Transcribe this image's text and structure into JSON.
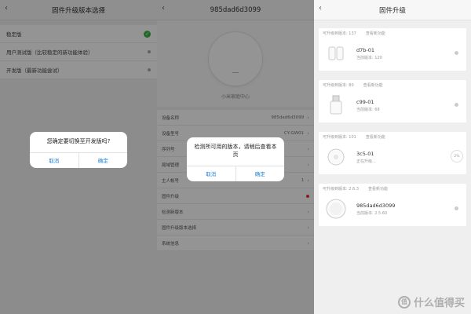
{
  "panel1": {
    "title": "固件升级版本选择",
    "back_icon": "chevron-left-icon",
    "options": [
      {
        "label": "稳定版",
        "state": "checked"
      },
      {
        "label": "用户测试版（比较稳定的新功能体验）",
        "state": "dot"
      },
      {
        "label": "开发版（最新功能尝试）",
        "state": "dot"
      }
    ],
    "dialog": {
      "message": "您确定要切换至开发版吗?",
      "cancel": "取消",
      "confirm": "确定"
    }
  },
  "panel2": {
    "title": "985dad6d3099",
    "back_icon": "chevron-left-icon",
    "device_label": "小米家庭中心",
    "rows": [
      {
        "label": "设备名称",
        "value": "985dad6d3099"
      },
      {
        "label": "设备型号",
        "value": "CY-GW01"
      },
      {
        "label": "序列号",
        "value": ""
      },
      {
        "label": "局域管理",
        "value": ""
      },
      {
        "label": "主人帐号",
        "value": "1"
      },
      {
        "label": "固件升级",
        "value": ""
      },
      {
        "label": "检测新版本",
        "value": ""
      },
      {
        "label": "固件升级版本选择",
        "value": ""
      },
      {
        "label": "系统信息",
        "value": ""
      }
    ],
    "dialog": {
      "message": "检测所可用的版本，请稍后查看本页",
      "cancel": "取消",
      "confirm": "确定"
    }
  },
  "panel3": {
    "title": "固件升级",
    "back_icon": "chevron-left-icon",
    "cards": [
      {
        "available": "可升级到版本: 137",
        "changelog": "查看新功能",
        "name": "d7b-01",
        "current": "当前版本: 120",
        "status": "dot"
      },
      {
        "available": "可升级到版本: 80",
        "changelog": "查看新功能",
        "name": "c99-01",
        "current": "当前版本: 68",
        "status": "dot"
      },
      {
        "available": "可升级到版本: 101",
        "changelog": "查看新功能",
        "name": "3c5-01",
        "current": "正在升级...",
        "status": "progress",
        "progress_text": "2%"
      },
      {
        "available": "可升级到版本: 2.6.3",
        "changelog": "查看新功能",
        "name": "985dad6d3099",
        "current": "当前版本: 2.5.60",
        "status": "dot"
      }
    ]
  },
  "watermark": "什么值得买",
  "colors": {
    "accent": "#1e7fd6",
    "check": "#3fb34f",
    "alert": "#e53935"
  }
}
